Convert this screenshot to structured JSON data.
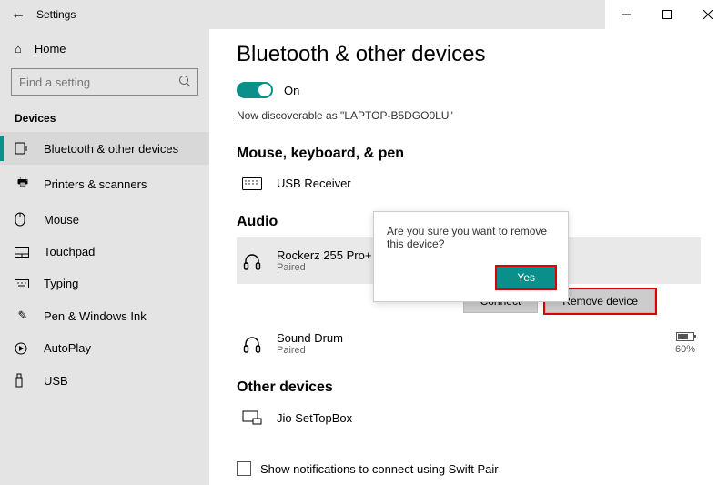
{
  "titlebar": {
    "title": "Settings"
  },
  "home": "Home",
  "search": {
    "placeholder": "Find a setting"
  },
  "section": "Devices",
  "nav": [
    {
      "label": "Bluetooth & other devices"
    },
    {
      "label": "Printers & scanners"
    },
    {
      "label": "Mouse"
    },
    {
      "label": "Touchpad"
    },
    {
      "label": "Typing"
    },
    {
      "label": "Pen & Windows Ink"
    },
    {
      "label": "AutoPlay"
    },
    {
      "label": "USB"
    }
  ],
  "page": {
    "title": "Bluetooth & other devices",
    "toggle_label": "On",
    "discoverable": "Now discoverable as \"LAPTOP-B5DGO0LU\"",
    "sec1": "Mouse, keyboard, & pen",
    "usb_receiver": "USB Receiver",
    "sec2": "Audio",
    "rockerz": {
      "name": "Rockerz 255 Pro+",
      "status": "Paired"
    },
    "connect": "Connect",
    "remove": "Remove device",
    "sound_drum": {
      "name": "Sound Drum",
      "status": "Paired",
      "batt": "60%"
    },
    "sec3": "Other devices",
    "jio": "Jio SetTopBox",
    "swift": "Show notifications to connect using Swift Pair"
  },
  "popup": {
    "msg": "Are you sure you want to remove this device?",
    "yes": "Yes"
  }
}
